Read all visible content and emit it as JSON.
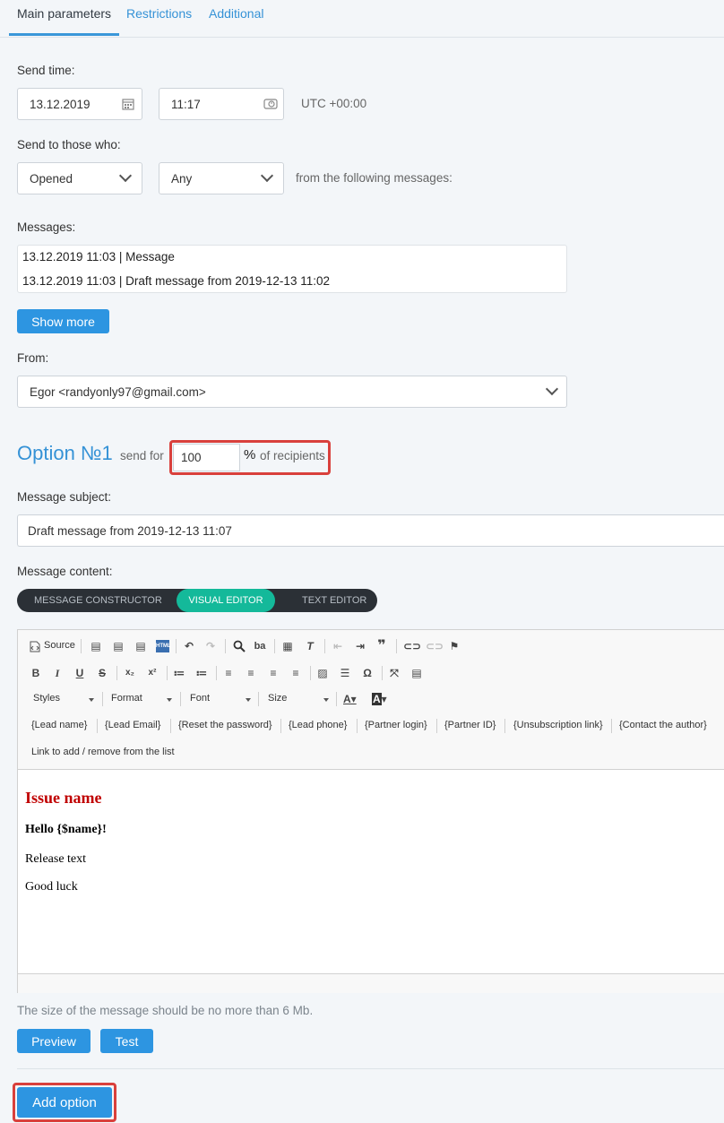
{
  "tabs": [
    {
      "label": "Main parameters",
      "active": true
    },
    {
      "label": "Restrictions",
      "active": false
    },
    {
      "label": "Additional",
      "active": false
    }
  ],
  "send_time": {
    "label": "Send time:",
    "date": "13.12.2019",
    "time": "11:17",
    "timezone": "UTC +00:00"
  },
  "send_to": {
    "label": "Send to those who:",
    "action": "Opened",
    "scope": "Any",
    "suffix": "from the following messages:"
  },
  "messages": {
    "label": "Messages:",
    "items": [
      "13.12.2019 11:03 | Message",
      "13.12.2019 11:03 | Draft message from 2019-12-13 11:02"
    ],
    "show_more": "Show more"
  },
  "from": {
    "label": "From:",
    "value": "Egor <randyonly97@gmail.com>"
  },
  "option": {
    "title": "Option №1",
    "send_for": "send for",
    "percent_value": "100",
    "percent_sign": "%",
    "of_recipients": "of recipients"
  },
  "subject": {
    "label": "Message subject:",
    "value": "Draft message from 2019-12-13 11:07"
  },
  "content": {
    "label": "Message content:",
    "modes": [
      "MESSAGE CONSTRUCTOR",
      "VISUAL EDITOR",
      "TEXT EDITOR"
    ],
    "active_mode": "VISUAL EDITOR"
  },
  "toolbar": {
    "source": "Source",
    "styles": "Styles",
    "format": "Format",
    "font": "Font",
    "size": "Size",
    "placeholders": [
      "{Lead name}",
      "{Lead Email}",
      "{Reset the password}",
      "{Lead phone}",
      "{Partner login}",
      "{Partner ID}",
      "{Unsubscription link}",
      "{Contact the author}"
    ],
    "list_link": "Link to add / remove from the list"
  },
  "body": {
    "heading": "Issue name",
    "greeting": "Hello {$name}!",
    "line1": "Release text",
    "line2": "Good luck"
  },
  "size_note": "The size of the message should be no more than 6 Mb.",
  "buttons": {
    "preview": "Preview",
    "test": "Test",
    "add_option": "Add option"
  },
  "colors": {
    "accent": "#2d95e1",
    "link": "#3592d6",
    "switch_active": "#14b99a",
    "highlight": "#d9403c",
    "heading_red": "#c00000"
  }
}
